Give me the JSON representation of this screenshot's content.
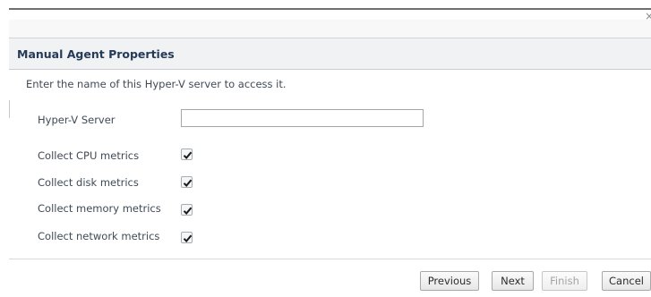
{
  "dialog": {
    "close_glyph": "×",
    "title": "Manual Agent Properties",
    "intro": "Enter the name of this Hyper-V server to access it."
  },
  "form": {
    "server_label": "Hyper-V Server",
    "server_value": "",
    "checkboxes": [
      {
        "label": "Collect CPU metrics",
        "checked": true
      },
      {
        "label": "Collect disk metrics",
        "checked": true
      },
      {
        "label": "Collect memory metrics",
        "checked": true
      },
      {
        "label": "Collect network metrics",
        "checked": true
      }
    ]
  },
  "buttons": {
    "previous": "Previous",
    "next": "Next",
    "finish": "Finish",
    "finish_enabled": false,
    "cancel": "Cancel"
  },
  "colors": {
    "title": "#253a58",
    "text": "#3f4a55",
    "header_bg": "#f1f2f4"
  },
  "icons": {
    "close": "close-icon",
    "check": "checkmark-icon"
  }
}
